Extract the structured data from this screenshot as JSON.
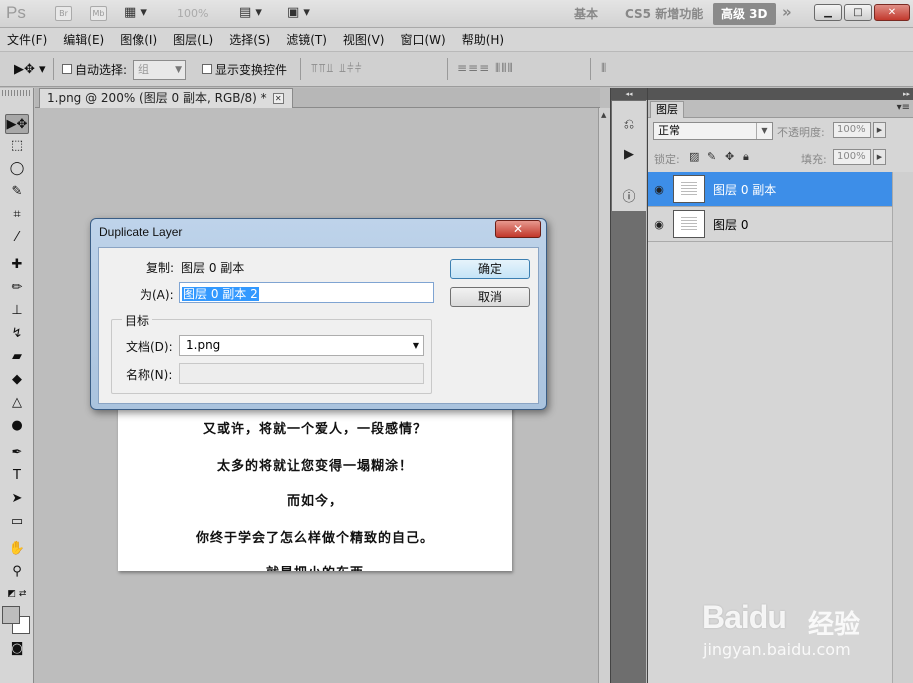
{
  "appbar": {
    "logo": "Ps",
    "bridge_label": "Br",
    "minibridge_label": "Mb",
    "zoom": "100%",
    "workspaces": [
      "基本",
      "CS5 新增功能",
      "高级 3D"
    ],
    "active_workspace": "高级 3D",
    "more": "»",
    "window_buttons": [
      "▁",
      "□",
      "✕"
    ]
  },
  "menu": [
    "文件(F)",
    "编辑(E)",
    "图像(I)",
    "图层(L)",
    "选择(S)",
    "滤镜(T)",
    "视图(V)",
    "窗口(W)",
    "帮助(H)"
  ],
  "options": {
    "auto_select_label": "自动选择:",
    "auto_select_value": "组",
    "show_transform_label": "显示变换控件"
  },
  "document": {
    "tab_title": "1.png @ 200% (图层 0 副本, RGB/8) *",
    "lines": [
      "又或许，将就一个爱人，一段感情？",
      "太多的将就让您变得一塌糊涂！",
      "而如今，",
      "你终于学会了怎么样做个精致的自己。",
      "就是把小的东西"
    ]
  },
  "layers_panel": {
    "tab": "图层",
    "blend_mode": "正常",
    "opacity_label": "不透明度:",
    "opacity_value": "100%",
    "lock_label": "锁定:",
    "fill_label": "填充:",
    "fill_value": "100%",
    "layers": [
      {
        "name": "图层 0 副本",
        "selected": true
      },
      {
        "name": "图层 0",
        "selected": false
      }
    ]
  },
  "dialog": {
    "title": "Duplicate Layer",
    "close": "✕",
    "copy_label": "复制:",
    "copy_value": "图层 0 副本",
    "as_label": "为(A):",
    "as_value": "图层 0 副本 2",
    "ok_label": "确定",
    "cancel_label": "取消",
    "target_group": "目标",
    "doc_label": "文档(D):",
    "doc_value": "1.png",
    "name_label": "名称(N):",
    "name_value": ""
  },
  "watermark": {
    "main": "Bai",
    "du": "du",
    "jingyan": "经验",
    "url": "jingyan.baidu.com"
  },
  "colors": {
    "selection_blue": "#3d8ee8",
    "dialog_frame": "#bed3ea",
    "close_red": "#c1372a"
  }
}
